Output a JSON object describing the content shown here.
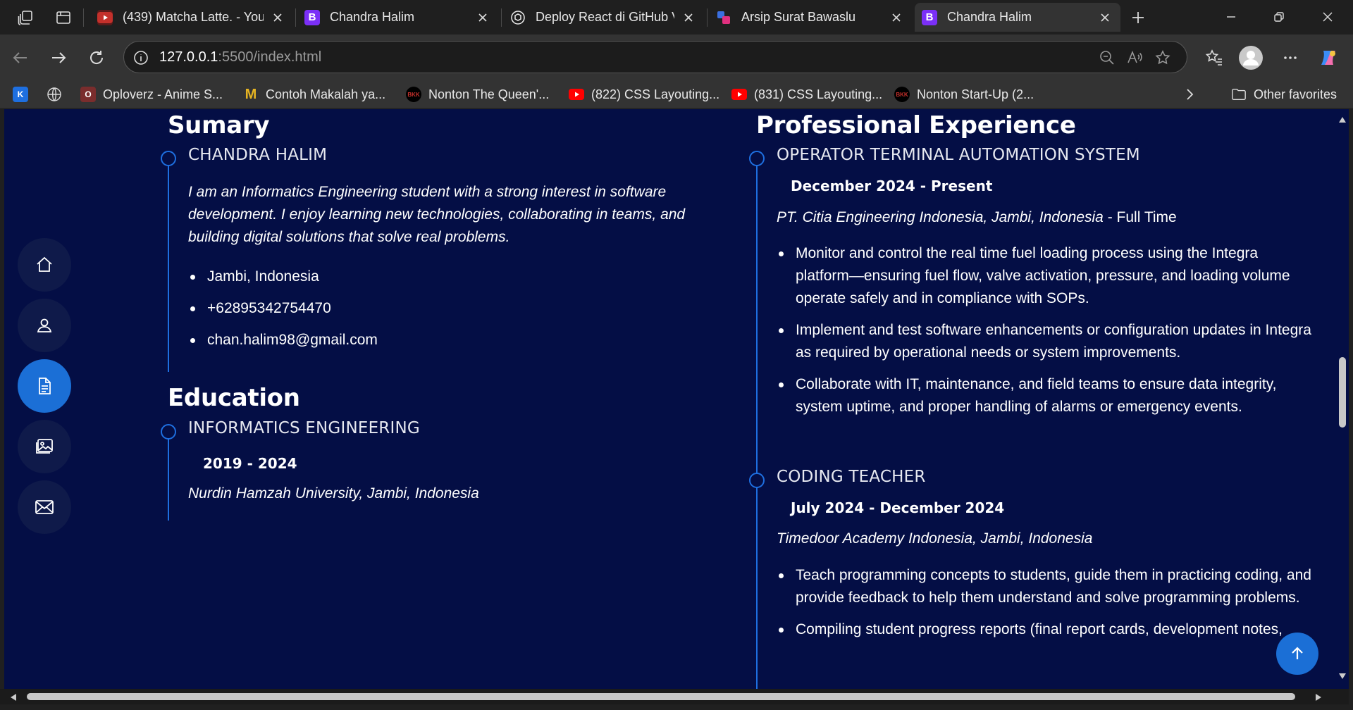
{
  "browser": {
    "tabs": [
      {
        "title": "(439) Matcha Latte. - You",
        "icon": "youtube-icon",
        "color": "#c4302b"
      },
      {
        "title": "Chandra Halim",
        "icon": "bootstrap-icon",
        "color": "#7b2ff7"
      },
      {
        "title": "Deploy React di GitHub V",
        "icon": "chatgpt-icon",
        "color": "#ffffff"
      },
      {
        "title": "Arsip Surat Bawaslu",
        "icon": "app-icon",
        "color": "#e0307f"
      },
      {
        "title": "Chandra Halim",
        "icon": "bootstrap-icon",
        "color": "#7b2ff7",
        "active": true
      }
    ],
    "address": {
      "host": "127.0.0.1",
      "path": ":5500/index.html"
    },
    "bookmarks": [
      {
        "label": "",
        "icon": "k-icon",
        "color": "#1e6fe0"
      },
      {
        "label": "",
        "icon": "globe-icon"
      },
      {
        "label": "Oploverz - Anime S...",
        "icon": "oploverz-icon",
        "color": "#c0392b"
      },
      {
        "label": "Contoh Makalah ya...",
        "icon": "m-icon",
        "color": "#e6b422"
      },
      {
        "label": "Nonton The Queen'...",
        "icon": "bkk-icon",
        "color": "#c4302b"
      },
      {
        "label": "(822) CSS Layouting...",
        "icon": "youtube-icon",
        "color": "#ff0000"
      },
      {
        "label": "(831) CSS Layouting...",
        "icon": "youtube-icon",
        "color": "#ff0000"
      },
      {
        "label": "Nonton Start-Up (2...",
        "icon": "bkk-icon",
        "color": "#c4302b"
      }
    ],
    "other_favorites": "Other favorites"
  },
  "resume": {
    "summary": {
      "title": "Sumary",
      "name": "CHANDRA HALIM",
      "text": "I am an Informatics Engineering student with a strong interest in software development. I enjoy learning new technologies, collaborating in teams, and building digital solutions that solve real problems.",
      "contacts": [
        "Jambi, Indonesia",
        "+62895342754470",
        "chan.halim98@gmail.com"
      ]
    },
    "education": {
      "title": "Education",
      "degree": "INFORMATICS ENGINEERING",
      "years": "2019 - 2024",
      "school": "Nurdin Hamzah University, Jambi, Indonesia"
    },
    "experience": {
      "title": "Professional Experience",
      "jobs": [
        {
          "role": "OPERATOR TERMINAL AUTOMATION SYSTEM",
          "period": "December 2024 - Present",
          "org": "PT. Citia Engineering Indonesia, Jambi, Indonesia",
          "type": " - Full Time",
          "points": [
            "Monitor and control the real time fuel loading process using the Integra platform—ensuring fuel flow, valve activation, pressure, and loading volume operate safely and in compliance with SOPs.",
            "Implement and test software enhancements or configuration updates in Integra as required by operational needs or system improvements.",
            "Collaborate with IT, maintenance, and field teams to ensure data integrity, system uptime, and proper handling of alarms or emergency events."
          ]
        },
        {
          "role": "CODING TEACHER",
          "period": "July 2024 - December 2024",
          "org": "Timedoor Academy Indonesia, Jambi, Indonesia",
          "points": [
            "Teach programming concepts to students, guide them in practicing coding, and provide feedback to help them understand and solve programming problems.",
            "Compiling student progress reports (final report cards, development notes,"
          ]
        }
      ]
    }
  },
  "nav": [
    "home-icon",
    "user-icon",
    "document-icon",
    "image-icon",
    "mail-icon"
  ],
  "colors": {
    "page_bg": "#040e45",
    "accent": "#1b6fd6",
    "nav_bg": "#0f1a4a"
  }
}
